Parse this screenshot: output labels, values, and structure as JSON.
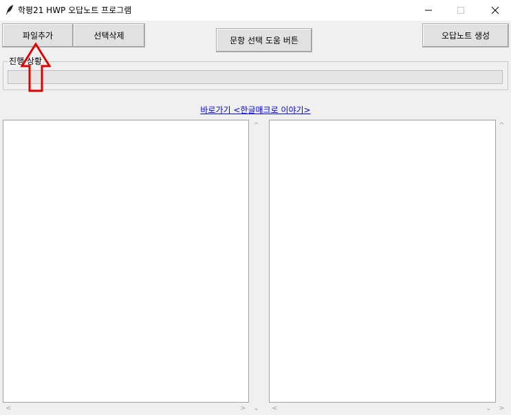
{
  "window": {
    "title": "학평21 HWP 오답노트 프로그램",
    "icon": "feather-icon"
  },
  "toolbar": {
    "add_file_label": "파일추가",
    "delete_selected_label": "선택삭제",
    "question_help_label": "문항 선택 도움 버튼",
    "generate_label": "오답노트 생성"
  },
  "progress": {
    "label": "진행 상황",
    "value": 0
  },
  "link": {
    "text": "바로가기 <한글매크로 이야기>"
  },
  "lists": {
    "left_items": [],
    "right_items": []
  },
  "colors": {
    "link": "#0000ee",
    "annotation_arrow": "#e00000",
    "window_bg": "#f0f0f0"
  },
  "icons": {
    "minimize": "minimize-icon",
    "maximize": "maximize-icon",
    "close": "close-icon",
    "annotation": "red-arrow-up-icon"
  }
}
